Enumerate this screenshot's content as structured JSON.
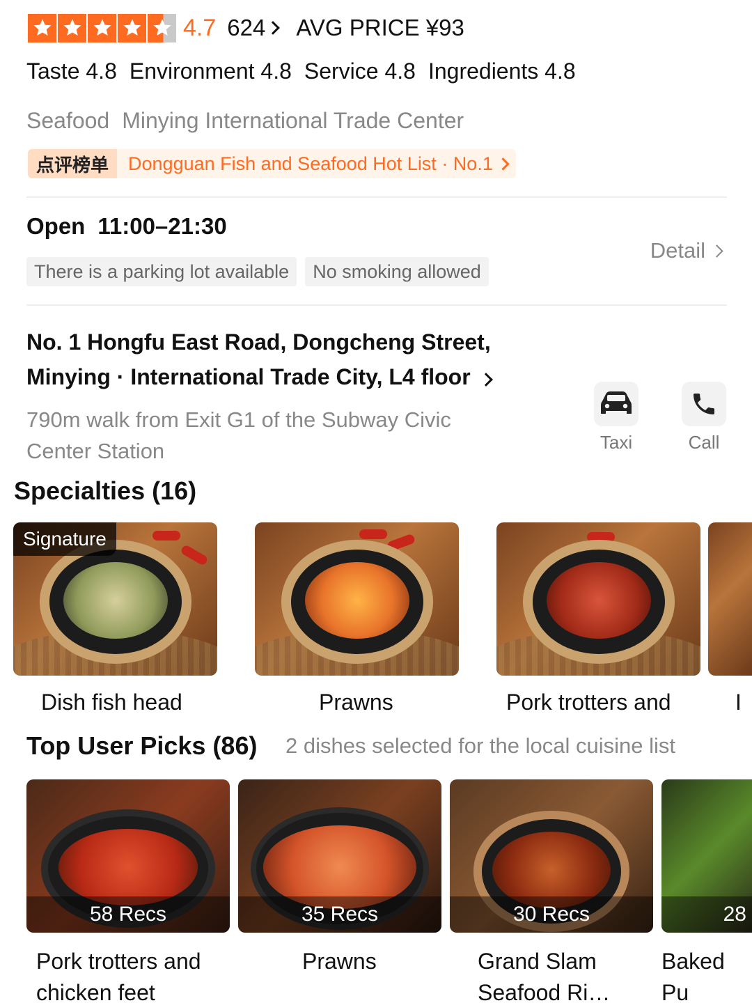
{
  "rating": {
    "score": "4.7",
    "stars": 4.5,
    "reviews": "624",
    "avg_price": "AVG PRICE ¥93"
  },
  "subscores": [
    {
      "label": "Taste 4.8"
    },
    {
      "label": "Environment 4.8"
    },
    {
      "label": "Service 4.8"
    },
    {
      "label": "Ingredients 4.8"
    }
  ],
  "meta": {
    "category": "Seafood",
    "area": "Minying International Trade Center"
  },
  "hotlist": {
    "badge": "点评榜单",
    "text": "Dongguan Fish and Seafood Hot List · No.1"
  },
  "hours": {
    "label": "Open",
    "time": "11:00–21:30",
    "detail": "Detail"
  },
  "tags": [
    "There is a parking lot available",
    "No smoking allowed"
  ],
  "address": {
    "line": "No. 1 Hongfu East Road, Dongcheng Street, Minying · International Trade City, L4 floor",
    "walk": "790m walk from Exit G1 of the Subway Civic Center Station"
  },
  "actions": {
    "taxi": "Taxi",
    "call": "Call"
  },
  "specialties": {
    "title": "Specialties (16)",
    "signature_badge": "Signature",
    "items": [
      {
        "name": "Dish fish head"
      },
      {
        "name": "Prawns"
      },
      {
        "name": "Pork trotters and"
      },
      {
        "name": "I"
      }
    ]
  },
  "picks": {
    "title": "Top User Picks (86)",
    "note": "2 dishes selected for the local cuisine list",
    "items": [
      {
        "recs": "58 Recs",
        "name": "Pork trotters and chicken feet"
      },
      {
        "recs": "35 Recs",
        "name": "Prawns"
      },
      {
        "recs": "30 Recs",
        "name": "Grand Slam Seafood Ri…"
      },
      {
        "recs": "28",
        "name": "Baked Pu (Baked w"
      }
    ]
  },
  "colors": {
    "accent": "#ff6a21",
    "muted": "#888888"
  }
}
